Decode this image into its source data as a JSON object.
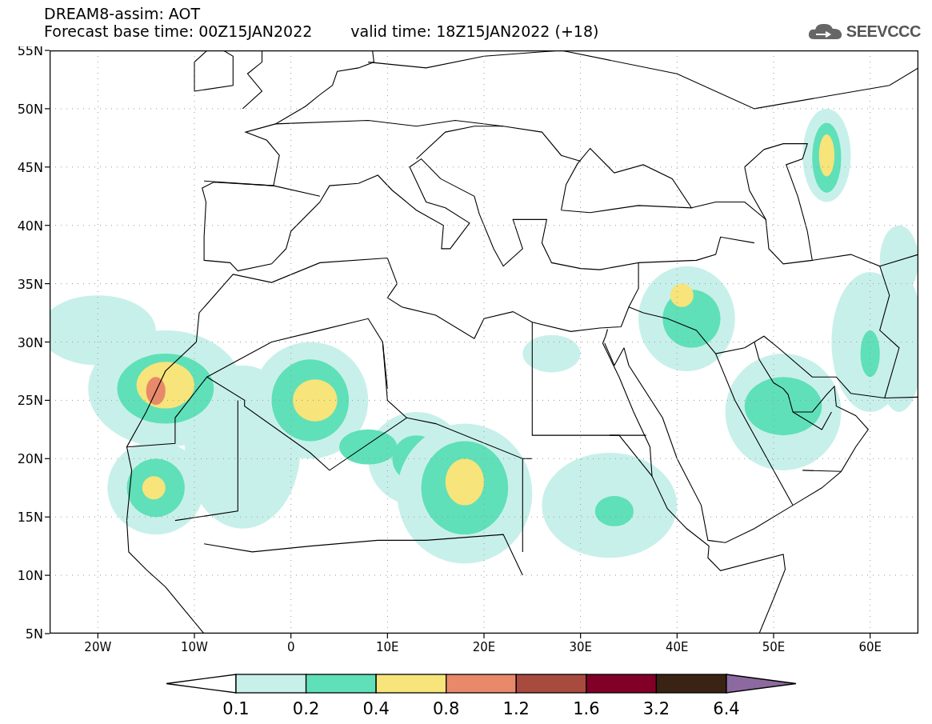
{
  "header": {
    "title": "DREAM8-assim: AOT",
    "base_time": "Forecast base time: 00Z15JAN2022",
    "valid_time": "valid time: 18Z15JAN2022 (+18)",
    "logo_text": "SEEVCCC"
  },
  "map": {
    "y_ticks": [
      "55N",
      "50N",
      "45N",
      "40N",
      "35N",
      "30N",
      "25N",
      "20N",
      "15N",
      "10N",
      "5N"
    ],
    "x_ticks": [
      "20W",
      "10W",
      "0",
      "10E",
      "20E",
      "30E",
      "40E",
      "50E",
      "60E"
    ]
  },
  "colorbar": {
    "labels": [
      "0.1",
      "0.2",
      "0.4",
      "0.8",
      "1.2",
      "1.6",
      "3.2",
      "6.4"
    ],
    "bins": [
      {
        "color": "#ffffff"
      },
      {
        "color": "#c8f0ea"
      },
      {
        "color": "#5fe0b8"
      },
      {
        "color": "#f7e47a"
      },
      {
        "color": "#e8896a"
      },
      {
        "color": "#a94a3f"
      },
      {
        "color": "#820028"
      },
      {
        "color": "#3a2312"
      },
      {
        "color": "#8c6aa0"
      }
    ]
  }
}
